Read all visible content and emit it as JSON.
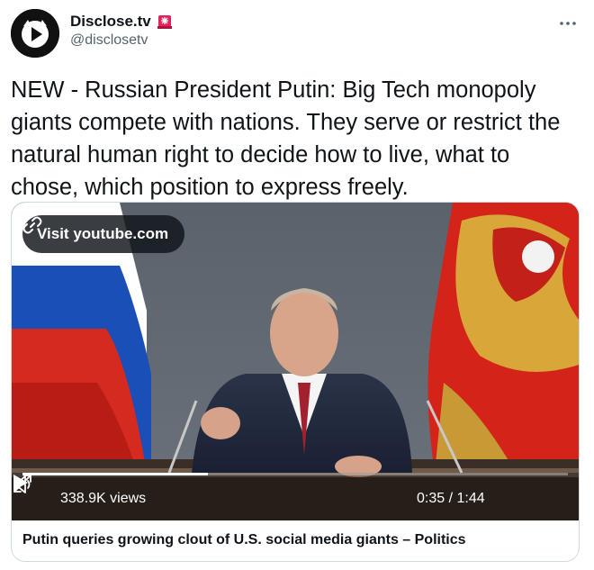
{
  "account": {
    "display_name": "Disclose.tv",
    "handle": "@disclosetv",
    "avatar_icon": "disclose-play-logo",
    "badge_icon": "siren-emoji",
    "more_icon": "more-dots"
  },
  "tweet": {
    "text": "NEW - Russian President Putin: Big Tech monopoly giants compete with nations. They serve or restrict the natural human right to decide how to live, what to chose, which position to express freely."
  },
  "card": {
    "visit_label": "Visit youtube.com",
    "views": "338.9K views",
    "time": "0:35 / 1:44",
    "progress_fraction": 0.34,
    "title": "Putin queries growing clout of U.S. social media giants – Politics"
  },
  "colors": {
    "text": "#0f1419",
    "secondary": "#536471",
    "border": "#cfd9de"
  }
}
